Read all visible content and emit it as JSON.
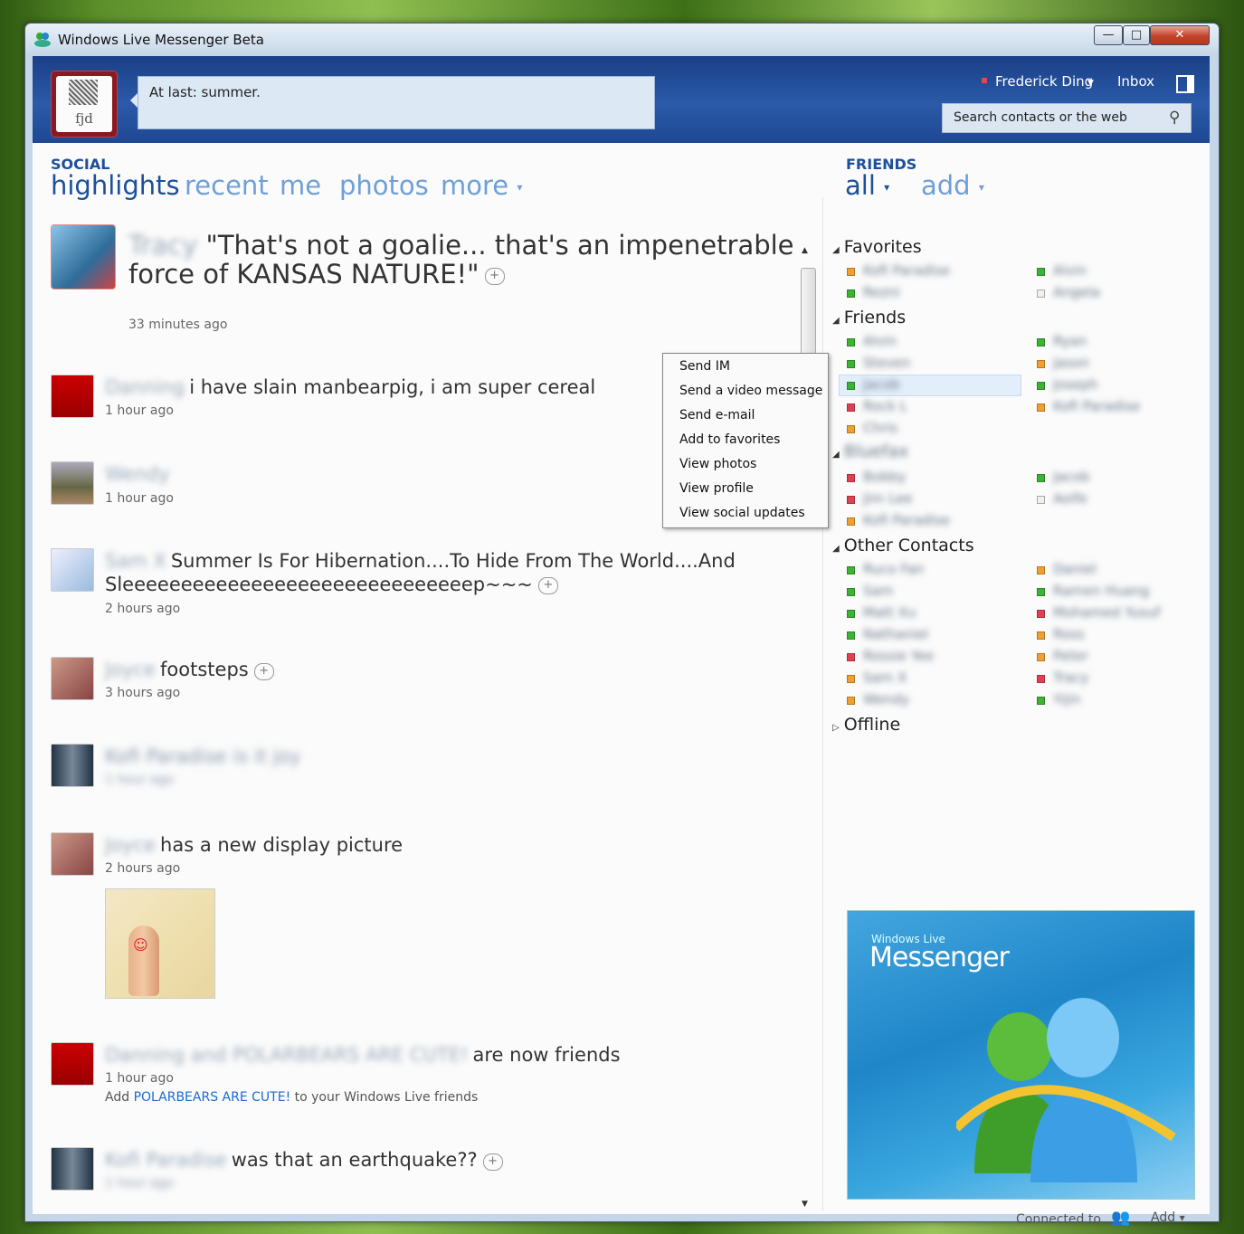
{
  "window": {
    "title": "Windows Live Messenger Beta",
    "minimize": "—",
    "maximize": "□",
    "close": "✕"
  },
  "header": {
    "avatar_text": "fjd",
    "personal_message": "At last: summer.",
    "user_name": "Frederick Ding",
    "inbox": "Inbox",
    "search_placeholder": "Search contacts or the web"
  },
  "social": {
    "heading": "SOCIAL",
    "tabs": [
      "highlights",
      "recent",
      "me",
      "photos",
      "more"
    ],
    "feed": [
      {
        "name": "Tracy",
        "text": "\"That's not a goalie... that's an impenetrable",
        "text2": "force of KANSAS NATURE!\"",
        "time": "33 minutes ago"
      },
      {
        "name": "Danning",
        "text": "i have slain manbearpig, i am super cereal",
        "time": "1 hour ago"
      },
      {
        "name": "Wendy",
        "text": "",
        "time": "1 hour ago"
      },
      {
        "name": "Sam X",
        "text": "Summer Is For Hibernation....To Hide From The World....And",
        "text2": "Sleeeeeeeeeeeeeeeeeeeeeeeeeeeeeep~~~",
        "time": "2 hours ago"
      },
      {
        "name": "Joyce",
        "text": "footsteps",
        "time": "3 hours ago"
      },
      {
        "name": "Kofi Paradise",
        "text": "is it joy",
        "time": "1 hour ago"
      },
      {
        "name": "Joyce",
        "text": "has a new display picture",
        "time": "2 hours ago"
      },
      {
        "name": "Danning and POLARBEARS ARE CUTE!",
        "text": "are now friends",
        "time": "1 hour ago",
        "add_prefix": "Add",
        "add_link": "POLARBEARS ARE CUTE!",
        "add_suffix": "to your Windows Live friends"
      },
      {
        "name": "Kofi Paradise",
        "text": "was that an earthquake??",
        "time": "1 hour ago"
      }
    ]
  },
  "context_menu": [
    "Send IM",
    "Send a video message",
    "Send e-mail",
    "Add to favorites",
    "View photos",
    "View profile",
    "View social updates"
  ],
  "friends": {
    "heading": "FRIENDS",
    "tabs": [
      "all",
      "add"
    ],
    "groups": [
      {
        "name": "Favorites"
      },
      {
        "name": "Friends"
      },
      {
        "name": "Bluefax"
      },
      {
        "name": "Other Contacts"
      },
      {
        "name": "Offline"
      }
    ],
    "contacts": {
      "favorites": [
        "Kofi Paradise",
        "Alvin",
        "Rezni",
        "Angela"
      ],
      "friends": [
        "Alvin",
        "Ryan",
        "Steven",
        "Jason",
        "Jacob",
        "Joseph",
        "Rock L",
        "Kofi Paradise",
        "Chris"
      ],
      "bluefax": [
        "Bobby",
        "Jacob",
        "Jim Lee",
        "Aoife",
        "Kofi Paradise"
      ],
      "other": [
        "Ruco Fan",
        "Daniel",
        "Sam",
        "Ramen Huang",
        "Matt Xu",
        "Mohamed Yusuf",
        "Nathaniel",
        "Ross",
        "Rossie Yee",
        "Peter",
        "Sam X",
        "Tracy",
        "Wendy",
        "Yijin"
      ]
    }
  },
  "ad": {
    "brand": "Windows Live",
    "product": "Messenger"
  },
  "footer": {
    "connected": "Connected to",
    "add": "Add"
  },
  "colors": {
    "accent": "#1d4f9a",
    "link": "#6f9fd8",
    "header": "#1b3f86",
    "online": "#3db335",
    "away": "#f0a030",
    "busy": "#e04050"
  }
}
